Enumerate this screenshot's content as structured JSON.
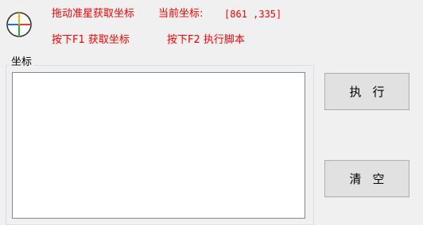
{
  "header": {
    "drag_hint": "拖动准星获取坐标",
    "current_label": "当前坐标:",
    "current_coords": "[861 ,335]",
    "f1_hint": "按下F1 获取坐标",
    "f2_hint": "按下F2 执行脚本"
  },
  "group": {
    "label": "坐标",
    "textarea_value": ""
  },
  "buttons": {
    "run_label": "执行",
    "clear_label": "清空"
  },
  "colors": {
    "hint_text": "#ff0000",
    "background": "#f0f0f0"
  },
  "icons": {
    "crosshair": "crosshair-target-icon"
  }
}
